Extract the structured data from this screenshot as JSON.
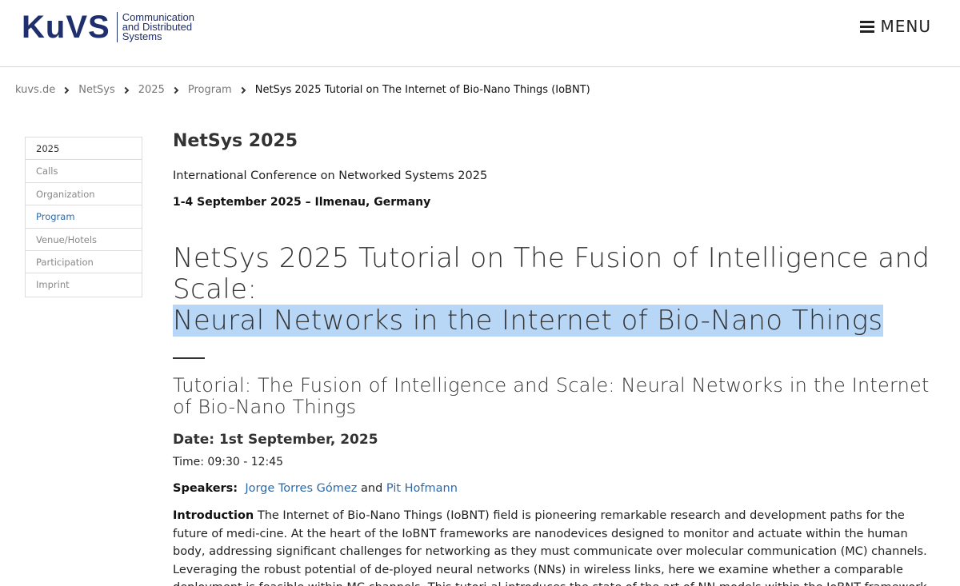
{
  "header": {
    "logo_mark": "KuVS",
    "logo_lines": [
      "Communication",
      "and Distributed",
      "Systems"
    ],
    "menu_label": "MENU"
  },
  "breadcrumb": [
    "kuvs.de",
    "NetSys",
    "2025",
    "Program",
    "NetSys 2025 Tutorial on The Internet of Bio-Nano Things (IoBNT)"
  ],
  "sidebar": {
    "items": [
      {
        "label": "2025",
        "state": "head"
      },
      {
        "label": "Calls",
        "state": ""
      },
      {
        "label": "Organization",
        "state": ""
      },
      {
        "label": "Program",
        "state": "active"
      },
      {
        "label": "Venue/Hotels",
        "state": ""
      },
      {
        "label": "Participation",
        "state": ""
      },
      {
        "label": "Imprint",
        "state": ""
      }
    ]
  },
  "main": {
    "conf_title": "NetSys 2025",
    "conf_subtitle": "International Conference on Networked Systems 2025",
    "conf_date": "1-4 September 2025 – Ilmenau, Germany",
    "page_title_line1": "NetSys 2025 Tutorial on The Fusion of Intelligence and Scale:",
    "page_title_line2": "Neural Networks in the Internet of Bio-Nano Things",
    "tutorial_title": "Tutorial: The Fusion of Intelligence and Scale: Neural Networks in the Internet of Bio-Nano Things",
    "tutorial_date": "Date: 1st September, 2025",
    "tutorial_time": "Time: 09:30 - 12:45",
    "speakers_label": "Speakers:",
    "speaker_1": "Jorge Torres Gómez",
    "speakers_and": "and",
    "speaker_2": "Pit Hofmann",
    "intro_label": "Introduction",
    "intro_text": "The Internet of Bio-Nano Things (IoBNT) field is pioneering remarkable research and development paths for the future of medi-cine. At the heart of the IoBNT frameworks are nanodevices designed to monitor and actuate within the human body, addressing significant challenges for networking as they must communicate over molecular communication (MC) channels. Leveraging the robust potential of de-ployed neural networks (NNs) in wireless links, here we examine whether a comparable deployment is feasible within MC channels. This tutori-al introduces the state of the art of NN models within the IoBNT framework. We highlight the essentials of NN-driven communication and com-"
  },
  "colors": {
    "brand_blue": "#1f2f6e",
    "brand_yellow": "#f0c419",
    "link_blue": "#2f6aa8",
    "highlight": "#b8d6f5"
  }
}
